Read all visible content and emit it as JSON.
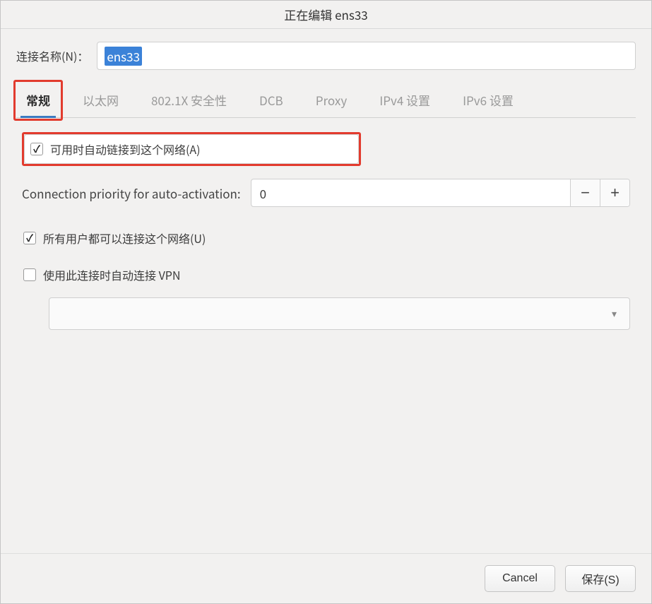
{
  "title": "正在编辑 ens33",
  "name_label": "连接名称(N)：",
  "name_value": "ens33",
  "tabs": [
    "常规",
    "以太网",
    "802.1X 安全性",
    "DCB",
    "Proxy",
    "IPv4 设置",
    "IPv6 设置"
  ],
  "general": {
    "auto_connect_label": "可用时自动链接到这个网络(A)",
    "auto_connect_checked": true,
    "priority_label": "Connection priority for auto-activation:",
    "priority_value": "0",
    "all_users_label": "所有用户都可以连接这个网络(U)",
    "all_users_checked": true,
    "vpn_label": "使用此连接时自动连接 VPN",
    "vpn_checked": false,
    "vpn_selected": ""
  },
  "buttons": {
    "cancel": "Cancel",
    "save": "保存(S)"
  }
}
